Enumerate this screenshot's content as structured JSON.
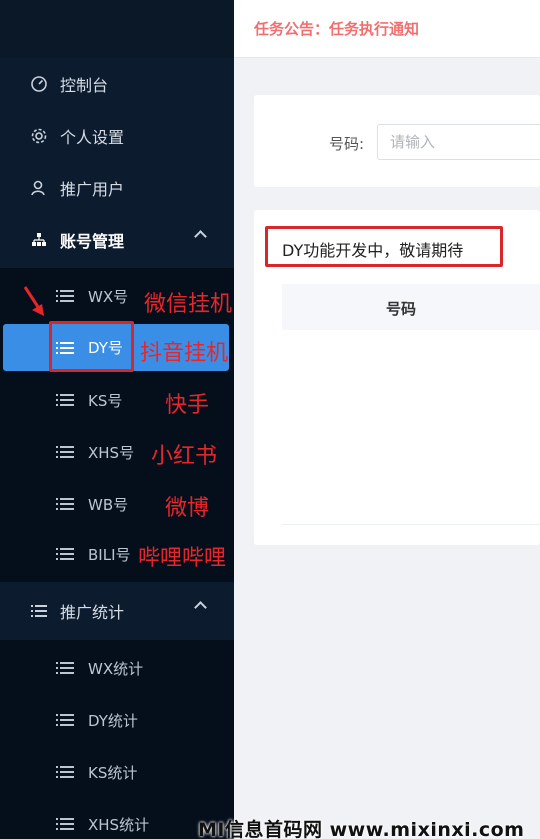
{
  "header": {
    "notice": "任务公告：任务执行通知"
  },
  "sidebar": {
    "items": [
      {
        "label": "控制台",
        "icon": "dashboard-icon"
      },
      {
        "label": "个人设置",
        "icon": "gear-icon"
      },
      {
        "label": "推广用户",
        "icon": "user-icon"
      },
      {
        "label": "账号管理",
        "icon": "sitemap-icon"
      }
    ],
    "account_sub": [
      "WX号",
      "DY号",
      "KS号",
      "XHS号",
      "WB号",
      "BILI号"
    ],
    "promo": {
      "label": "推广统计",
      "icon": "list-icon"
    },
    "promo_sub": [
      "WX统计",
      "DY统计",
      "KS统计",
      "XHS统计"
    ]
  },
  "annotations": [
    "微信挂机",
    "抖音挂机",
    "快手",
    "小红书",
    "微博",
    "哔哩哔哩"
  ],
  "search": {
    "label": "号码:",
    "placeholder": "请输入"
  },
  "main": {
    "dev_notice": "DY功能开发中，敬请期待",
    "table_header": "号码"
  },
  "watermark": "MI信息首码网 www.mixinxi.com",
  "colors": {
    "sidebar": "#0c1b2e",
    "active": "#3a8ee6",
    "annotation": "#e8262a",
    "notice": "#f07070"
  }
}
